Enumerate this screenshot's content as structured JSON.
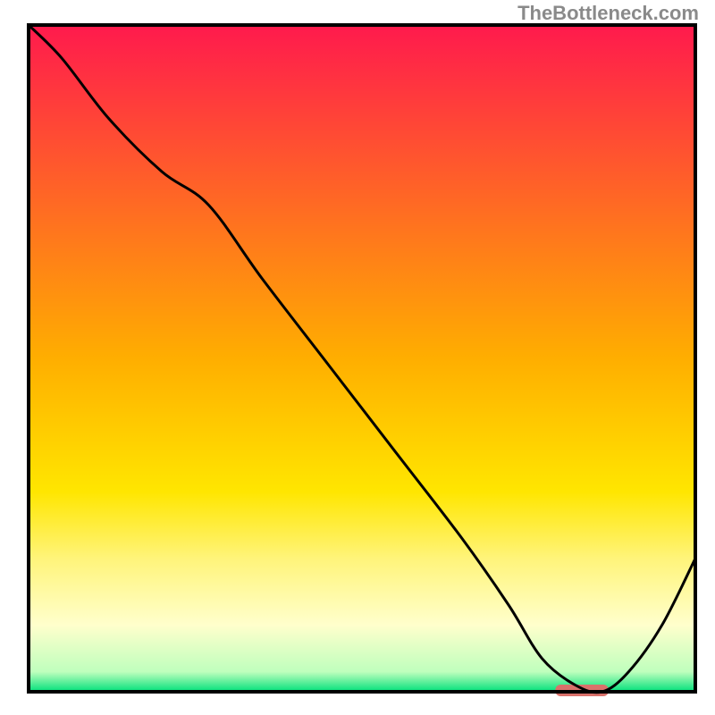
{
  "watermark": "TheBottleneck.com",
  "chart_data": {
    "type": "line",
    "title": "",
    "xlabel": "",
    "ylabel": "",
    "xlim": [
      0,
      100
    ],
    "ylim": [
      0,
      100
    ],
    "grid": false,
    "background": {
      "gradient": [
        {
          "offset": 0.0,
          "color": "#ff1a4d"
        },
        {
          "offset": 0.5,
          "color": "#ffae00"
        },
        {
          "offset": 0.7,
          "color": "#ffe600"
        },
        {
          "offset": 0.8,
          "color": "#fff47a"
        },
        {
          "offset": 0.9,
          "color": "#ffffcc"
        },
        {
          "offset": 0.97,
          "color": "#bfffbd"
        },
        {
          "offset": 1.0,
          "color": "#00e07a"
        }
      ]
    },
    "series": [
      {
        "name": "bottleneck-curve",
        "color": "#000000",
        "x": [
          0,
          5,
          12,
          20,
          27,
          35,
          45,
          55,
          65,
          72,
          77,
          82,
          86,
          90,
          95,
          100
        ],
        "y": [
          100,
          95,
          86,
          78,
          73,
          62,
          49,
          36,
          23,
          13,
          5,
          1,
          0,
          3,
          10,
          20
        ]
      }
    ],
    "marker": {
      "name": "optimal-range",
      "x_start": 79,
      "x_end": 87,
      "y": 0,
      "color": "#d9716b"
    }
  }
}
